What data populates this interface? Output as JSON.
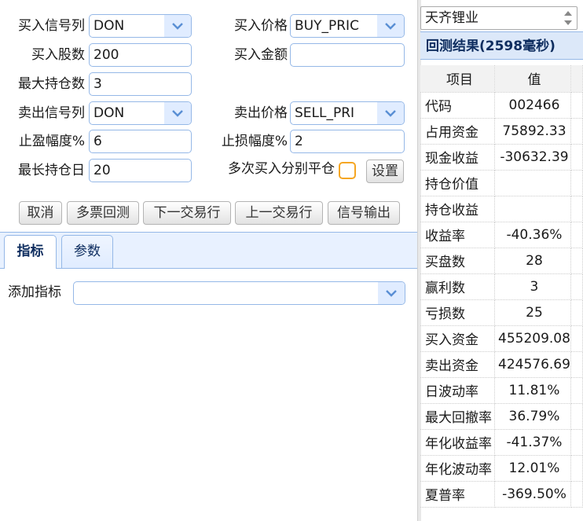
{
  "form": {
    "buy_signal": {
      "label": "买入信号列",
      "value": "DON"
    },
    "buy_price": {
      "label": "买入价格",
      "value": "BUY_PRIC"
    },
    "buy_shares": {
      "label": "买入股数",
      "value": "200"
    },
    "buy_amount": {
      "label": "买入金额",
      "value": ""
    },
    "max_positions": {
      "label": "最大持仓数",
      "value": "3"
    },
    "sell_signal": {
      "label": "卖出信号列",
      "value": "DON"
    },
    "sell_price": {
      "label": "卖出价格",
      "value": "SELL_PRI"
    },
    "take_profit": {
      "label": "止盈幅度%",
      "value": "6"
    },
    "stop_loss": {
      "label": "止损幅度%",
      "value": "2"
    },
    "max_hold_days": {
      "label": "最长持仓日",
      "value": "20"
    },
    "multi_buy": {
      "label": "多次买入分别平仓",
      "checked": false
    },
    "settings_label": "设置"
  },
  "actions": {
    "cancel": "取消",
    "multi_backtest": "多票回测",
    "next_row": "下一交易行",
    "prev_row": "上一交易行",
    "signal_output": "信号输出"
  },
  "tabs": [
    {
      "label": "指标",
      "active": true
    },
    {
      "label": "参数",
      "active": false
    }
  ],
  "indicator": {
    "label": "添加指标",
    "value": ""
  },
  "right": {
    "stock_select": "天齐锂业",
    "result_title": "回测结果(2598毫秒)",
    "table": {
      "headers": [
        "项目",
        "值"
      ],
      "rows": [
        [
          "代码",
          "002466"
        ],
        [
          "占用资金",
          "75892.33"
        ],
        [
          "现金收益",
          "-30632.39"
        ],
        [
          "持仓价值",
          ""
        ],
        [
          "持仓收益",
          ""
        ],
        [
          "收益率",
          "-40.36%"
        ],
        [
          "买盘数",
          "28"
        ],
        [
          "赢利数",
          "3"
        ],
        [
          "亏损数",
          "25"
        ],
        [
          "买入资金",
          "455209.08"
        ],
        [
          "卖出资金",
          "424576.69"
        ],
        [
          "日波动率",
          "11.81%"
        ],
        [
          "最大回撤率",
          "36.79%"
        ],
        [
          "年化收益率",
          "-41.37%"
        ],
        [
          "年化波动率",
          "12.01%"
        ],
        [
          "夏普率",
          "-369.50%"
        ]
      ]
    }
  },
  "colors": {
    "border": "#95b8e7",
    "arrow_bg": "#e0ecff",
    "header_bg": "#e8f1ff",
    "checkbox": "#f5a623"
  }
}
